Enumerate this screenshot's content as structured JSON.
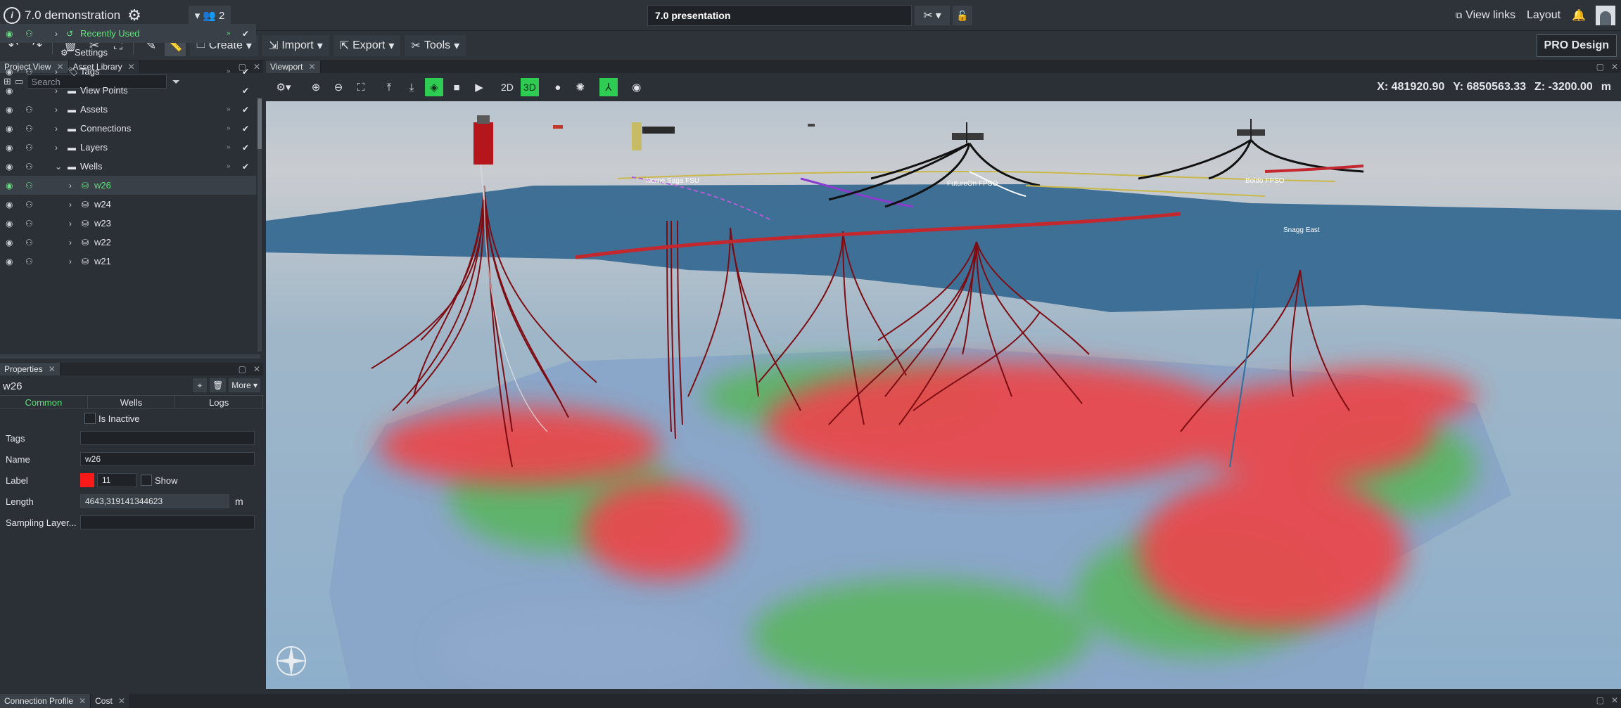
{
  "app": {
    "project_name": "7.0 demonstration",
    "collaborators": "2",
    "presentation": "7.0 presentation"
  },
  "header": {
    "view_links": "View links",
    "layout": "Layout"
  },
  "toolbar": {
    "create": "Create",
    "import": "Import",
    "export": "Export",
    "tools": "Tools",
    "pro_design": "PRO Design"
  },
  "panels": {
    "project_view": "Project View",
    "asset_library": "Asset Library",
    "properties": "Properties",
    "viewport": "Viewport",
    "connection_profile": "Connection Profile",
    "cost": "Cost"
  },
  "search": {
    "placeholder": "Search"
  },
  "tree": {
    "items": [
      {
        "label": "Recently Used"
      },
      {
        "label": "Settings"
      },
      {
        "label": "Tags"
      },
      {
        "label": "View Points"
      },
      {
        "label": "Assets"
      },
      {
        "label": "Connections"
      },
      {
        "label": "Layers"
      },
      {
        "label": "Wells"
      },
      {
        "label": "w26"
      },
      {
        "label": "w24"
      },
      {
        "label": "w23"
      },
      {
        "label": "w22"
      },
      {
        "label": "w21"
      }
    ]
  },
  "properties": {
    "title": "w26",
    "more": "More",
    "tabs": [
      "Common",
      "Wells",
      "Logs"
    ],
    "inactive_label": "Is Inactive",
    "tags_label": "Tags",
    "name_label": "Name",
    "name_value": "w26",
    "label_label": "Label",
    "label_size": "11",
    "show_label": "Show",
    "length_label": "Length",
    "length_value": "4643,319141344623",
    "length_unit": "m",
    "sampling_label": "Sampling Layer..."
  },
  "viewport": {
    "btn_2d": "2D",
    "btn_3d": "3D",
    "coord_x": "X: 481920.90",
    "coord_y": "Y: 6850563.33",
    "coord_z": "Z: -3200.00",
    "unit": "m"
  },
  "scene_labels": {
    "fsu": "Norne Saga FSU",
    "fpso1": "FutureOn FPSO",
    "fpso2": "Boldo FPSO",
    "field": "Snagg East"
  },
  "colors": {
    "accent": "#2ecc52",
    "sea": "#3b6f9a",
    "hot": "#e8484e"
  }
}
